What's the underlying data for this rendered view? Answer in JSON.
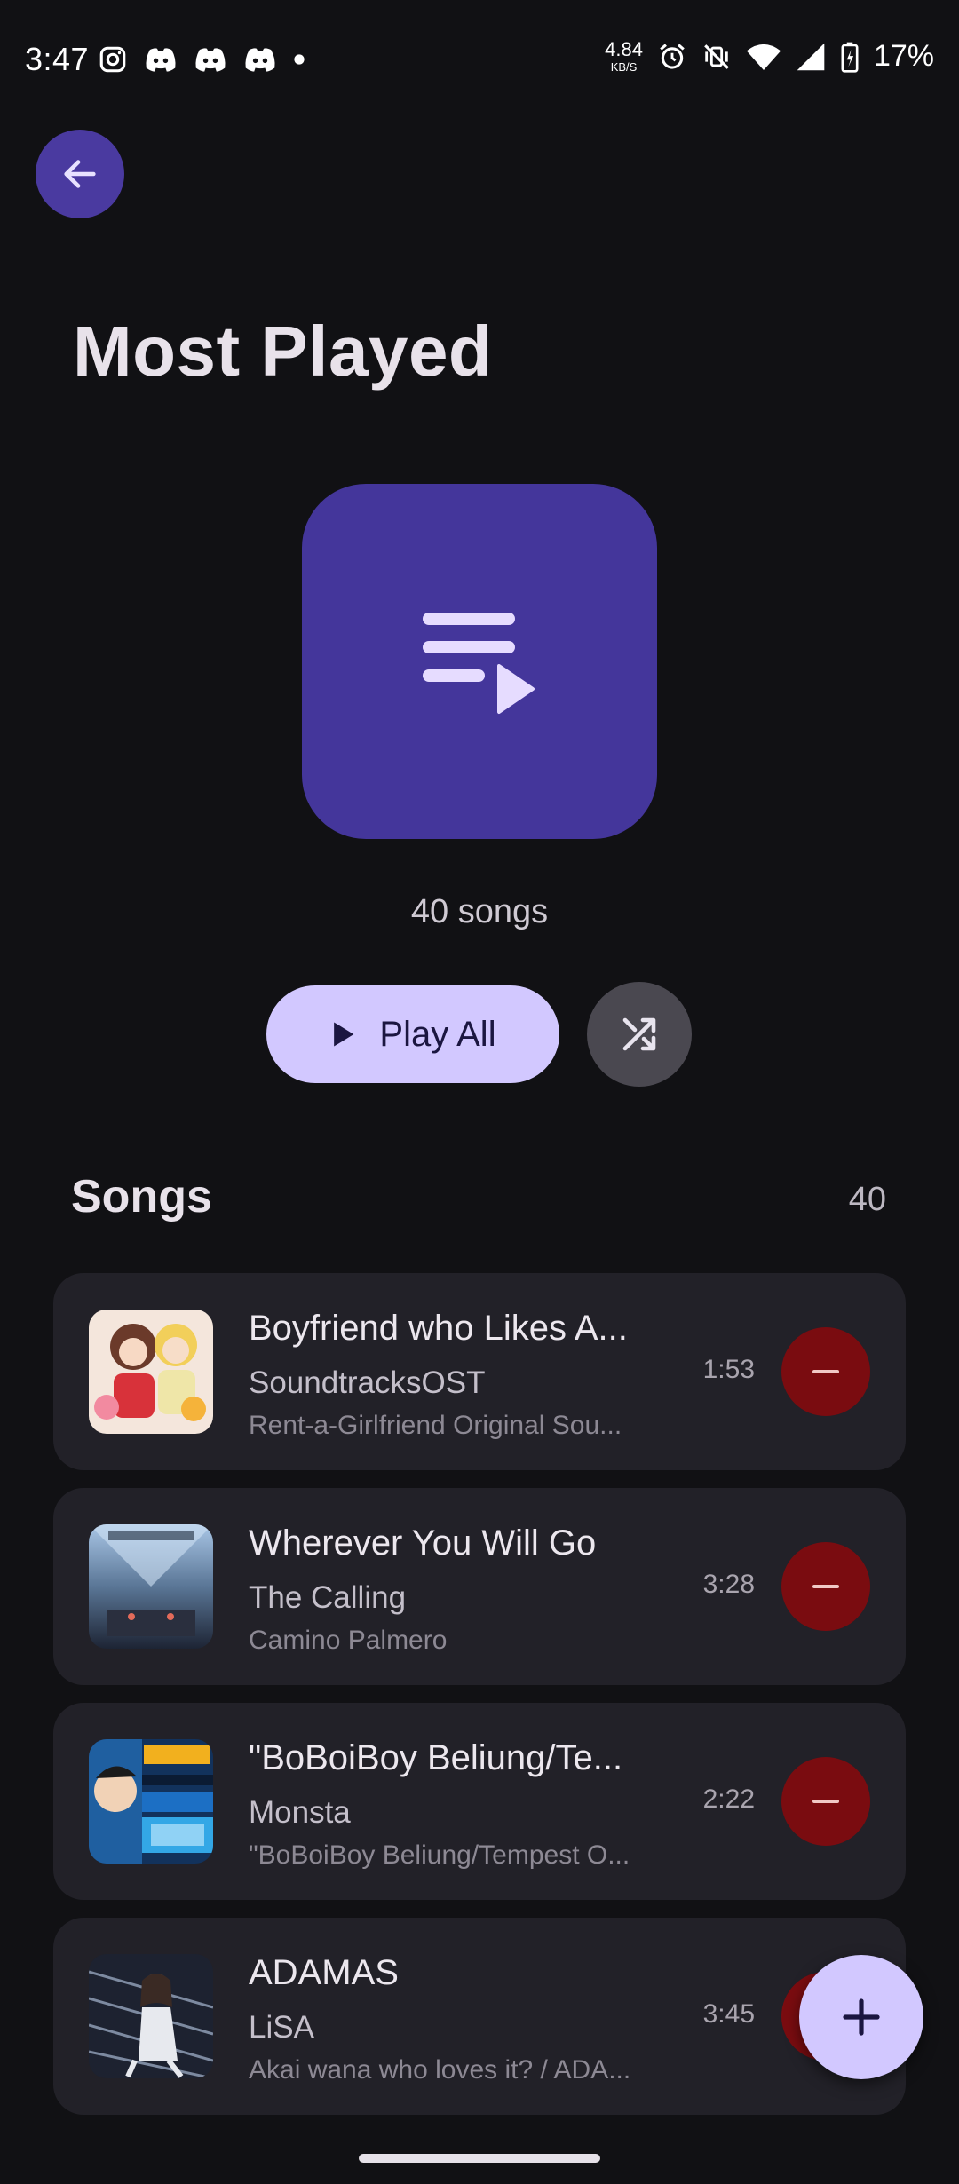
{
  "status_bar": {
    "time": "3:47",
    "net_speed_value": "4.84",
    "net_speed_unit": "KB/S",
    "battery": "17%",
    "left_icons": [
      "instagram-icon",
      "discord-icon",
      "discord-icon",
      "discord-icon",
      "dot-icon"
    ],
    "right_icons": [
      "alarm-icon",
      "vibrate-off-icon",
      "wifi-icon",
      "signal-icon",
      "battery-charging-icon"
    ]
  },
  "header": {
    "title": "Most Played"
  },
  "playlist": {
    "song_count_label": "40 songs",
    "art_icon": "playlist-play-icon"
  },
  "actions": {
    "play_all_label": "Play All",
    "shuffle_icon": "shuffle-icon"
  },
  "songs_section": {
    "title": "Songs",
    "count": "40",
    "items": [
      {
        "title": "Boyfriend who Likes A...",
        "artist": "SoundtracksOST",
        "album": "Rent-a-Girlfriend Original Sou...",
        "duration": "1:53"
      },
      {
        "title": "Wherever You Will Go",
        "artist": "The Calling",
        "album": "Camino Palmero",
        "duration": "3:28"
      },
      {
        "title": "\"BoBoiBoy Beliung/Te...",
        "artist": "Monsta",
        "album": "\"BoBoiBoy Beliung/Tempest O...",
        "duration": "2:22"
      },
      {
        "title": "ADAMAS",
        "artist": "LiSA",
        "album": "Akai wana who loves it? / ADA...",
        "duration": "3:45"
      }
    ]
  },
  "colors": {
    "background": "#111114",
    "accent": "#4a3aa0",
    "art_bg": "#44369b",
    "primary_container": "#d2c8ff",
    "remove": "#7a0c10",
    "card": "#222128"
  }
}
